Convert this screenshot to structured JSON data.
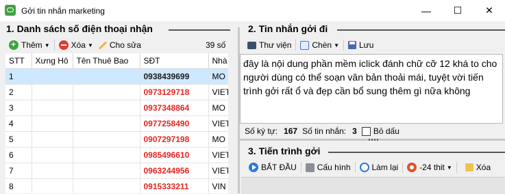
{
  "window": {
    "title": "Gởi tin nhắn marketing",
    "minimize_glyph": "—",
    "maximize_glyph": "☐",
    "close_glyph": "✕"
  },
  "left_panel": {
    "title": "1. Danh sách số điện thoại nhận",
    "toolbar": {
      "add_label": "Thêm",
      "delete_label": "Xóa",
      "edit_label": "Cho sửa",
      "count_label": "39 số"
    },
    "columns": [
      "STT",
      "Xưng Hô",
      "Tên Thuê Bao",
      "SĐT",
      "Nhà"
    ],
    "rows": [
      {
        "stt": "1",
        "title": "",
        "name": "",
        "phone": "0938439699",
        "carrier": "MO",
        "selected": true
      },
      {
        "stt": "2",
        "title": "",
        "name": "",
        "phone": "0973129718",
        "carrier": "VIET"
      },
      {
        "stt": "3",
        "title": "",
        "name": "",
        "phone": "0937348864",
        "carrier": "MO"
      },
      {
        "stt": "4",
        "title": "",
        "name": "",
        "phone": "0977258490",
        "carrier": "VIET"
      },
      {
        "stt": "5",
        "title": "",
        "name": "",
        "phone": "0907297198",
        "carrier": "MO"
      },
      {
        "stt": "6",
        "title": "",
        "name": "",
        "phone": "0985496610",
        "carrier": "VIET"
      },
      {
        "stt": "7",
        "title": "",
        "name": "",
        "phone": "0963244956",
        "carrier": "VIET"
      },
      {
        "stt": "8",
        "title": "",
        "name": "",
        "phone": "0915333211",
        "carrier": "VIN"
      }
    ]
  },
  "message_panel": {
    "title": "2. Tin nhắn gởi đi",
    "toolbar": {
      "library_label": "Thư viện",
      "insert_label": "Chèn",
      "save_label": "Lưu"
    },
    "message_text": "đây là nội dung phần mềm iclick đánh chữ cỡ 12 khá to cho người dùng có thể soạn văn bản thoải mái, tuyệt vời tiến trình gởi rất ổ và đẹp cần bổ sung thêm gì nữa không",
    "char_count_label": "Số ký tự:",
    "char_count": "167",
    "sms_count_label": "Số tin nhắn:",
    "sms_count": "3",
    "remove_accent_label": "Bỏ dấu"
  },
  "progress_panel": {
    "title": "3. Tiến trình gởi",
    "toolbar": {
      "start_label": "BẮT ĐẦU",
      "config_label": "Cấu hình",
      "redo_label": "Làm lại",
      "filter_label": "-24 thit",
      "clear_label": "Xóa"
    }
  },
  "colors": {
    "phone_text": "#e8241f",
    "selected_row": "#cde8ff",
    "accent_blue": "#2f78d4"
  }
}
